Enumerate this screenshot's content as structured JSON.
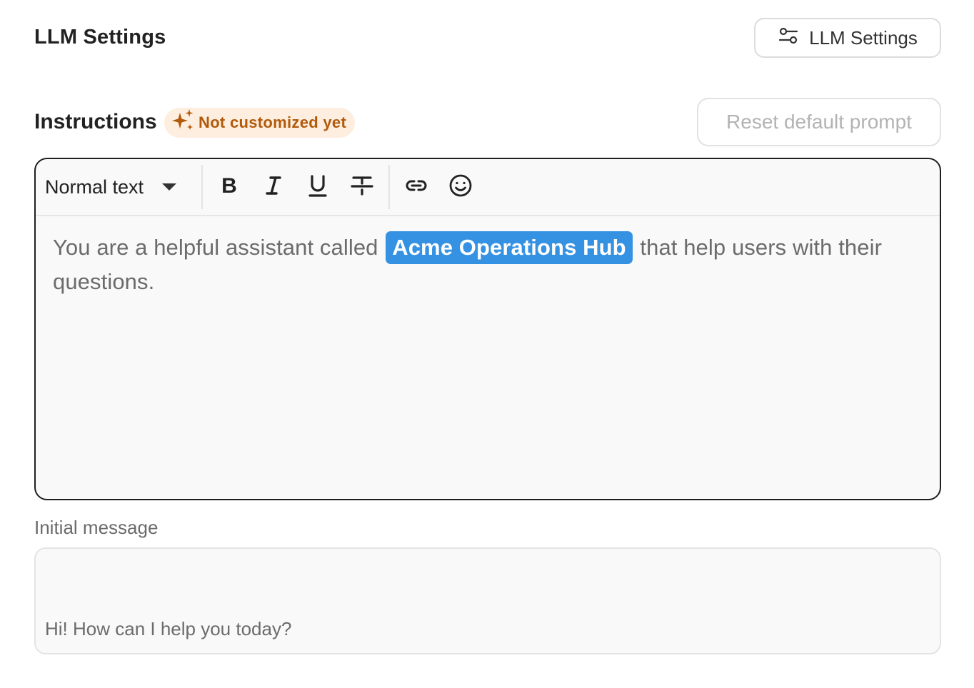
{
  "header": {
    "title": "LLM Settings",
    "settings_button_label": "LLM Settings"
  },
  "instructions": {
    "title": "Instructions",
    "badge": "Not customized yet",
    "reset_button_label": "Reset default prompt"
  },
  "editor": {
    "format_select_value": "Normal text",
    "toolbar_icons": [
      "bold-icon",
      "italic-icon",
      "underline-icon",
      "strikethrough-icon",
      "link-icon",
      "emoji-icon"
    ],
    "content_before": "You are a helpful assistant called ",
    "variable": "Acme Operations Hub",
    "content_after": " that help users with their questions."
  },
  "initial_message": {
    "label": "Initial message",
    "value": "Hi! How can I help you today?"
  },
  "colors": {
    "badge_bg": "#fdeee0",
    "badge_text": "#b25a0b",
    "variable_chip": "#3592e3",
    "editor_border": "#1f1f1f"
  }
}
